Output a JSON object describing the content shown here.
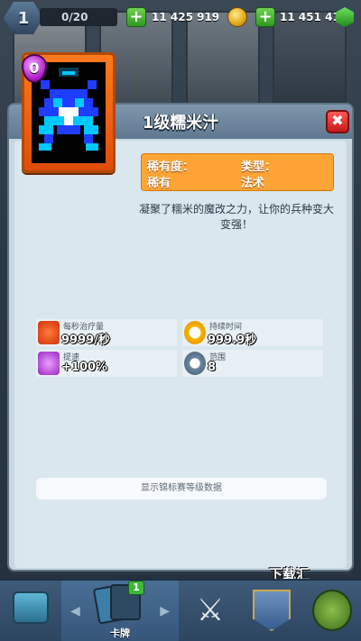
{
  "topbar": {
    "level": "1",
    "xp": "0/20",
    "gold": "11 425 919",
    "gems": "11 451 419",
    "plus": "+",
    "colors": {
      "gold": "#e0a818",
      "gem": "#2fb52a"
    }
  },
  "modal": {
    "title": "1级糯米汁",
    "close_label": "✖",
    "card": {
      "elixir_cost": "0",
      "art_colors": {
        "frame": "#ff7a1e",
        "body": "#1e3dff",
        "accent": "#00c8ff"
      }
    },
    "info": {
      "rarity_label": "稀有度：",
      "rarity_value": "稀有",
      "type_label": "类型：",
      "type_value": "法术"
    },
    "description": "凝聚了糯米的魔改之力，让你的兵种变大变强！",
    "stats": [
      {
        "label": "每秒治疗量",
        "value": "9999/秒",
        "icon": "heart-icon"
      },
      {
        "label": "持续时间",
        "value": "999.9秒",
        "icon": "clock-icon"
      },
      {
        "label": "提速",
        "value": "+100%",
        "icon": "speed-icon"
      },
      {
        "label": "范围",
        "value": "8",
        "icon": "range-icon"
      }
    ],
    "tournament_button": "显示锦标赛等级数据"
  },
  "nav": {
    "cards_label": "卡牌",
    "cards_badge": "1",
    "arrow_left": "◀",
    "arrow_right": "▶",
    "battle_glyph": "⚔"
  },
  "watermark": "下载汇"
}
